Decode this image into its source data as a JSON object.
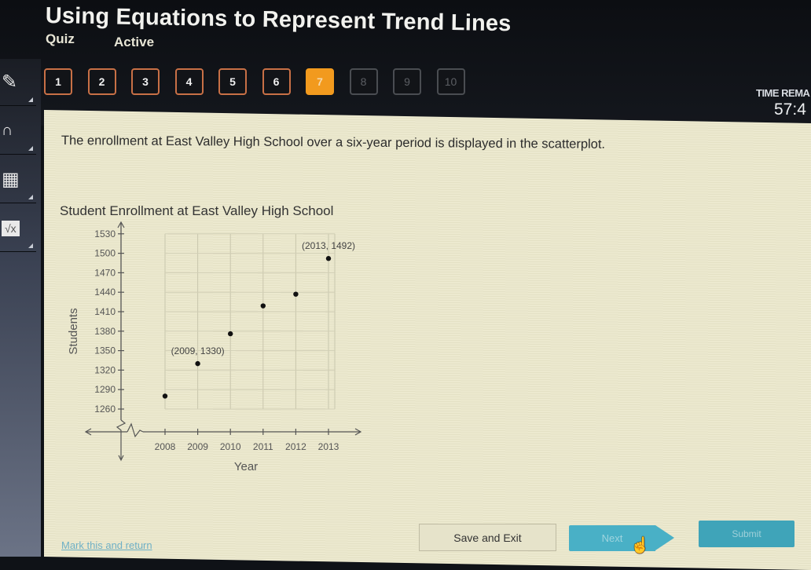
{
  "header": {
    "title": "Using Equations to Represent Trend Lines",
    "type_label": "Quiz",
    "status_label": "Active",
    "time_label": "TIME REMA",
    "time_value": "57:4"
  },
  "question_nav": [
    {
      "label": "1",
      "state": "answered"
    },
    {
      "label": "2",
      "state": "answered"
    },
    {
      "label": "3",
      "state": "answered"
    },
    {
      "label": "4",
      "state": "answered"
    },
    {
      "label": "5",
      "state": "answered"
    },
    {
      "label": "6",
      "state": "answered"
    },
    {
      "label": "7",
      "state": "current"
    },
    {
      "label": "8",
      "state": "locked"
    },
    {
      "label": "9",
      "state": "locked"
    },
    {
      "label": "10",
      "state": "locked"
    }
  ],
  "sidebar": {
    "tools": [
      {
        "name": "pencil-icon",
        "glyph": "✎"
      },
      {
        "name": "headphones-icon",
        "glyph": "🎧"
      },
      {
        "name": "calculator-icon",
        "glyph": "▦"
      },
      {
        "name": "formula-icon",
        "glyph": "√x"
      }
    ]
  },
  "question": {
    "prompt": "The enrollment at East Valley High School over a six-year period is displayed in the scatterplot."
  },
  "chart_data": {
    "type": "scatter",
    "title": "Student Enrollment at East Valley High School",
    "xlabel": "Year",
    "ylabel": "Students",
    "x_ticks": [
      "2008",
      "2009",
      "2010",
      "2011",
      "2012",
      "2013"
    ],
    "y_ticks": [
      "1260",
      "1290",
      "1320",
      "1350",
      "1380",
      "1410",
      "1440",
      "1470",
      "1500",
      "1530"
    ],
    "xlim": [
      2007,
      2014
    ],
    "ylim": [
      1230,
      1540
    ],
    "axis_break": true,
    "grid": true,
    "points": [
      {
        "x": 2008,
        "y": 1280
      },
      {
        "x": 2009,
        "y": 1330
      },
      {
        "x": 2010,
        "y": 1376
      },
      {
        "x": 2011,
        "y": 1419
      },
      {
        "x": 2012,
        "y": 1437
      },
      {
        "x": 2013,
        "y": 1492
      }
    ],
    "annotations": [
      {
        "x": 2009,
        "y": 1330,
        "text": "(2009, 1330)"
      },
      {
        "x": 2013,
        "y": 1492,
        "text": "(2013, 1492)"
      }
    ]
  },
  "footer": {
    "mark_link": "Mark this and return",
    "save_label": "Save and Exit",
    "next_label": "Next",
    "submit_label": "Submit"
  },
  "colors": {
    "accent_orange": "#f29a1e",
    "answered_border": "#c87046",
    "button_teal": "#49b0c6"
  }
}
